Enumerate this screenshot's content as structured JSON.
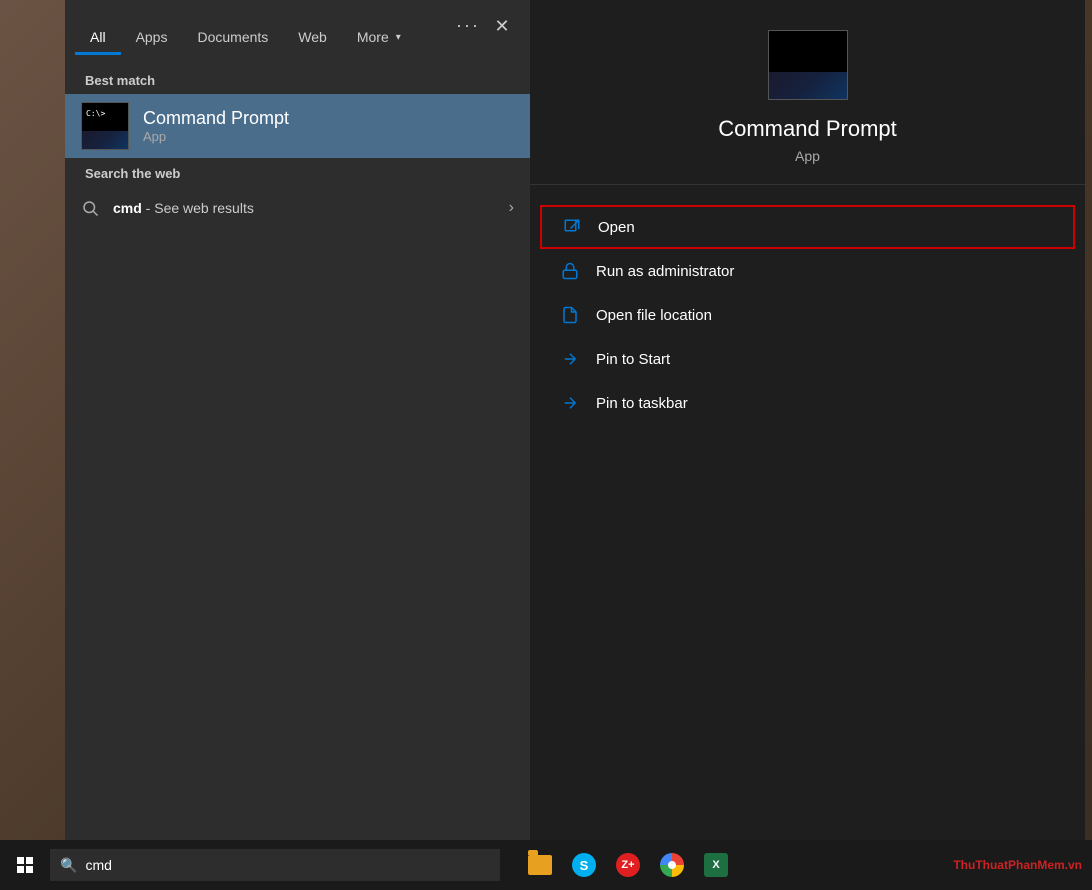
{
  "tabs": {
    "items": [
      {
        "label": "All",
        "active": true
      },
      {
        "label": "Apps"
      },
      {
        "label": "Documents"
      },
      {
        "label": "Web"
      },
      {
        "label": "More",
        "has_chevron": true
      }
    ]
  },
  "results": {
    "best_match_label": "Best match",
    "selected_app": {
      "name": "Command Prompt",
      "type": "App"
    }
  },
  "web_search": {
    "label": "Search the web",
    "query": "cmd",
    "suffix": " - See web results"
  },
  "right_panel": {
    "app_name": "Command Prompt",
    "app_type": "App",
    "actions": [
      {
        "label": "Open",
        "icon": "open-icon",
        "highlighted": true
      },
      {
        "label": "Run as administrator",
        "icon": "admin-icon",
        "highlighted": false
      },
      {
        "label": "Open file location",
        "icon": "file-location-icon",
        "highlighted": false
      },
      {
        "label": "Pin to Start",
        "icon": "pin-start-icon",
        "highlighted": false
      },
      {
        "label": "Pin to taskbar",
        "icon": "pin-taskbar-icon",
        "highlighted": false
      }
    ]
  },
  "taskbar": {
    "search_placeholder": "cmd",
    "app_icons": [
      "folder",
      "skype",
      "zoo",
      "chrome",
      "excel"
    ]
  },
  "header": {
    "three_dots_label": "···",
    "close_label": "✕"
  }
}
